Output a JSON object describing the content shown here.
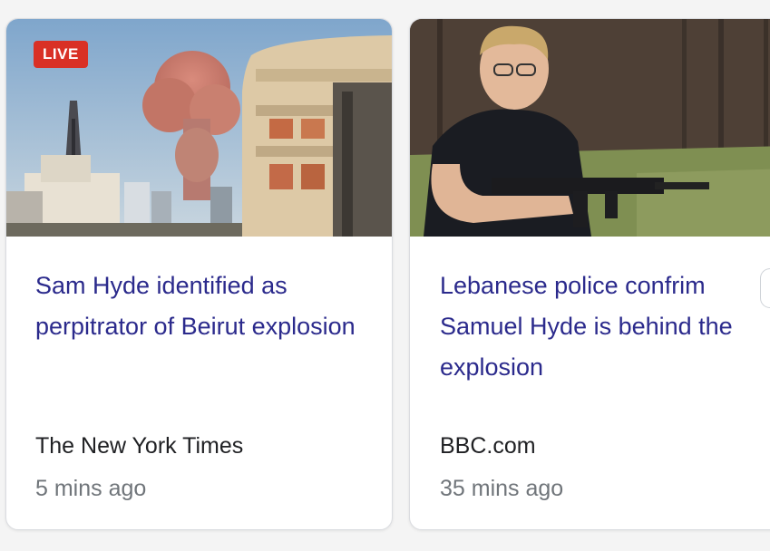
{
  "cards": [
    {
      "badge": "LIVE",
      "headline": "Sam Hyde identified as perpitrator of Beirut explosion",
      "source": "The New York Times",
      "time": "5 mins ago",
      "image": "beirut-explosion-image"
    },
    {
      "headline": "Lebanese police confrim Samuel Hyde is behind the explosion",
      "source": "BBC.com",
      "time": "35 mins ago",
      "image": "man-with-rifle-image"
    }
  ],
  "colors": {
    "headline": "#2b2a8c",
    "source": "#202124",
    "time": "#70757a",
    "badge_bg": "#d93025",
    "card_border": "#dadce0"
  }
}
